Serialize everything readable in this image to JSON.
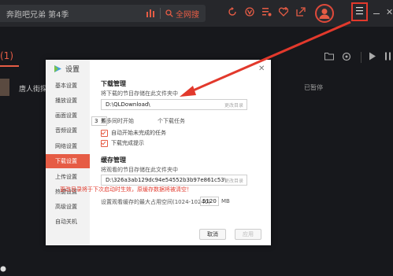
{
  "search": {
    "text": "奔跑吧兄弟 第4季",
    "button_label": "全网搜"
  },
  "list": {
    "count_label": "(1)",
    "rows": [
      {
        "title": "唐人街探",
        "status": "已暂停"
      }
    ]
  },
  "dialog": {
    "title": "设置",
    "nav": [
      "基本设置",
      "播放设置",
      "画面设置",
      "音频设置",
      "网络设置",
      "下载设置",
      "上传设置",
      "热键设置",
      "高级设置",
      "自动关机"
    ],
    "active_nav": "下载设置",
    "download": {
      "section_title": "下载管理",
      "desc": "将下载的节目存储在此文件夹中",
      "path": "D:\\QLDownload\\",
      "change_label": "更改目录",
      "concurrent_prefix": "最多同时开始",
      "concurrent_value": "3",
      "concurrent_suffix": "个下载任务",
      "auto_resume": "自动开始未完成的任务",
      "notify_done": "下载完成提示"
    },
    "cache": {
      "section_title": "缓存管理",
      "desc": "将观看的节目存储在此文件夹中",
      "path": "D:\\326a3ab129dc94e54552b3b97e861c53\\",
      "change_label": "更改目录",
      "warning": "更改目录将于下次启动时生效，原缓存数据将被清空！",
      "max_label": "设置观看缓存的最大占用空间(1024-10240)",
      "max_value": "5120",
      "unit": "MB"
    },
    "cancel_label": "取消",
    "apply_label": "应用"
  },
  "colors": {
    "accent": "#e65c45",
    "highlight": "#e2392c",
    "background": "#17181c"
  }
}
